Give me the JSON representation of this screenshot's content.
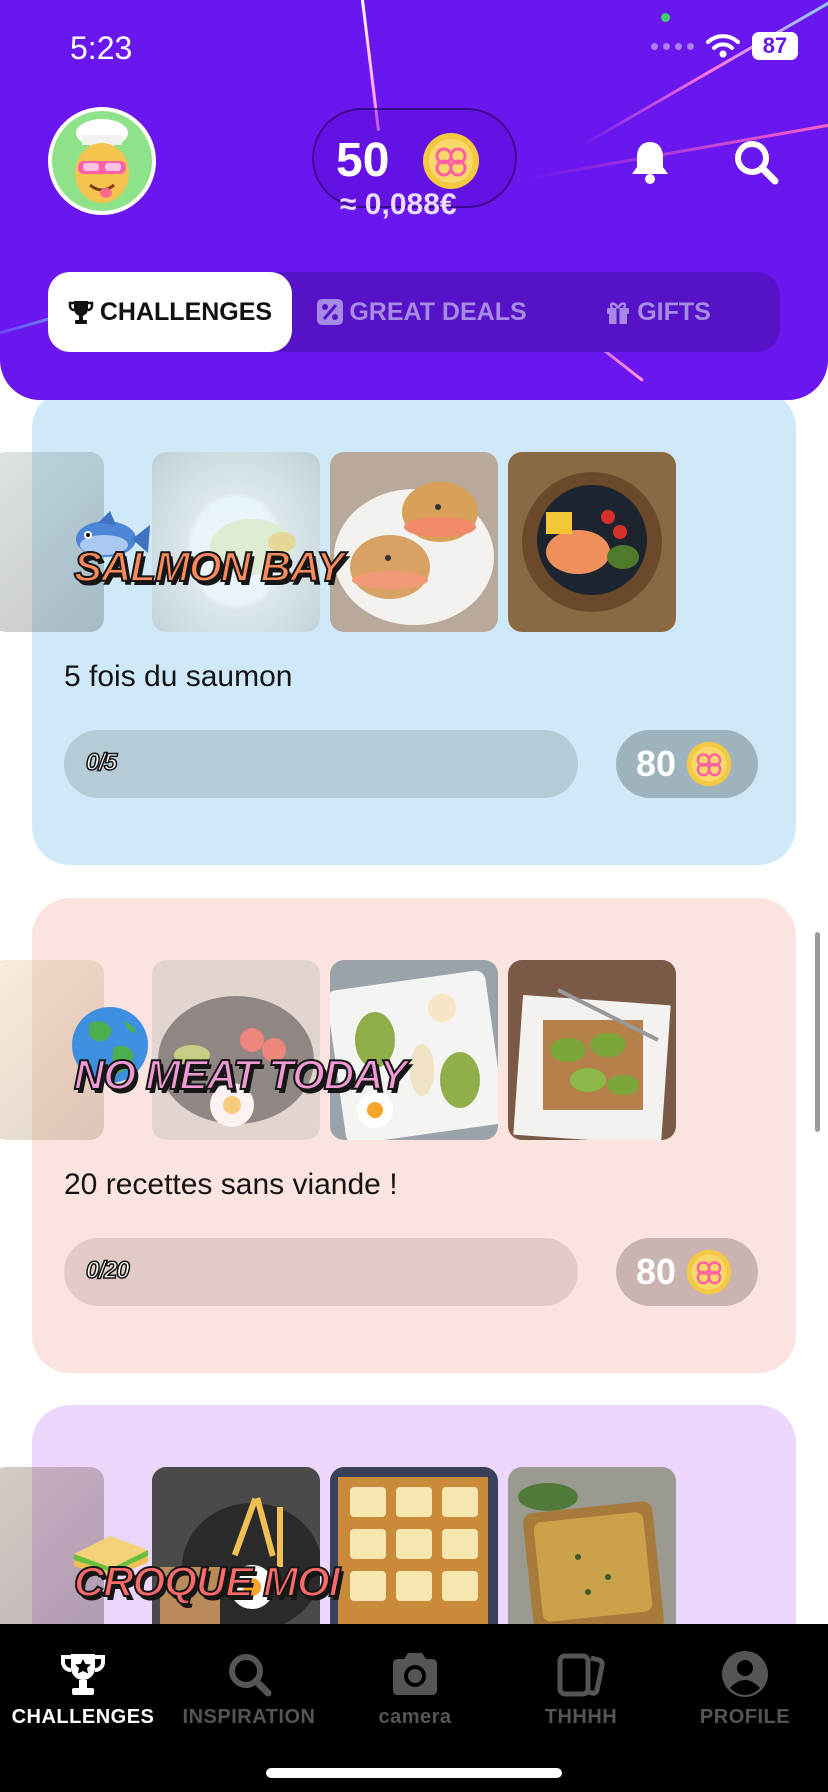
{
  "status_bar": {
    "time": "5:23",
    "battery": "87"
  },
  "header": {
    "balance": "50",
    "balance_euro": "≈ 0,088€",
    "avatar_icon": "chef-avatar-icon",
    "notification_icon": "bell-icon",
    "search_icon": "search-icon"
  },
  "tabs": [
    {
      "label": "CHALLENGES",
      "icon": "trophy-icon",
      "active": true
    },
    {
      "label": "GREAT DEALS",
      "icon": "percent-icon",
      "active": false
    },
    {
      "label": "GIFTS",
      "icon": "gift-icon",
      "active": false
    }
  ],
  "challenges": [
    {
      "title": "SALMON BAY",
      "emoji": "fish-icon",
      "description": "5 fois du saumon",
      "progress_label": "0/5",
      "progress_fraction": 0,
      "reward": "80",
      "bg_color": "#cfe9f8",
      "title_color": "#ff8a5c"
    },
    {
      "title": "NO MEAT TODAY",
      "emoji": "globe-icon",
      "description": "20 recettes sans viande !",
      "progress_label": "0/20",
      "progress_fraction": 0,
      "reward": "80",
      "bg_color": "#fbe4e0",
      "title_color": "#f29ad6"
    },
    {
      "title": "CROQUE MOI",
      "emoji": "sandwich-icon",
      "description": "",
      "progress_label": "",
      "reward": "",
      "bg_color": "#ecd6fb",
      "title_color": "#ff6b6b"
    }
  ],
  "bottom_nav": [
    {
      "label": "CHALLENGES",
      "icon": "trophy-icon",
      "active": true
    },
    {
      "label": "INSPIRATION",
      "icon": "search-icon",
      "active": false
    },
    {
      "label": "camera",
      "icon": "camera-icon",
      "active": false
    },
    {
      "label": "THHHH",
      "icon": "cards-icon",
      "active": false
    },
    {
      "label": "PROFILE",
      "icon": "profile-icon",
      "active": false
    }
  ],
  "colors": {
    "header_bg": "#6a16ee",
    "coin": "#f5c842"
  }
}
